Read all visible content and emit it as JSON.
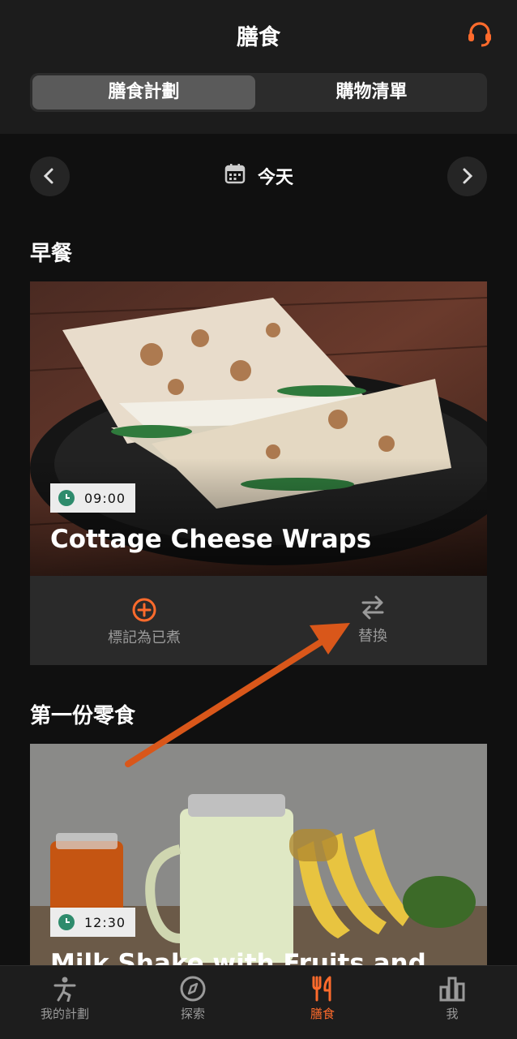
{
  "header": {
    "title": "膳食"
  },
  "segment": {
    "tab_plan": "膳食計劃",
    "tab_shopping": "購物清單"
  },
  "date_nav": {
    "label": "今天"
  },
  "meals": [
    {
      "section": "早餐",
      "time": "09:00",
      "name": "Cottage Cheese Wraps",
      "mark_cooked_label": "標記為已煮",
      "replace_label": "替換"
    },
    {
      "section": "第一份零食",
      "time": "12:30",
      "name": "Milk Shake with Fruits and"
    }
  ],
  "bottom_nav": {
    "items": [
      {
        "label": "我的計劃",
        "icon": "fitness-person-icon"
      },
      {
        "label": "探索",
        "icon": "compass-icon"
      },
      {
        "label": "膳食",
        "icon": "fork-knife-icon"
      },
      {
        "label": "我",
        "icon": "bar-chart-icon"
      }
    ]
  },
  "colors": {
    "accent": "#ff6b2c",
    "clock": "#2e8b6c",
    "annotation_arrow": "#d9571a"
  }
}
